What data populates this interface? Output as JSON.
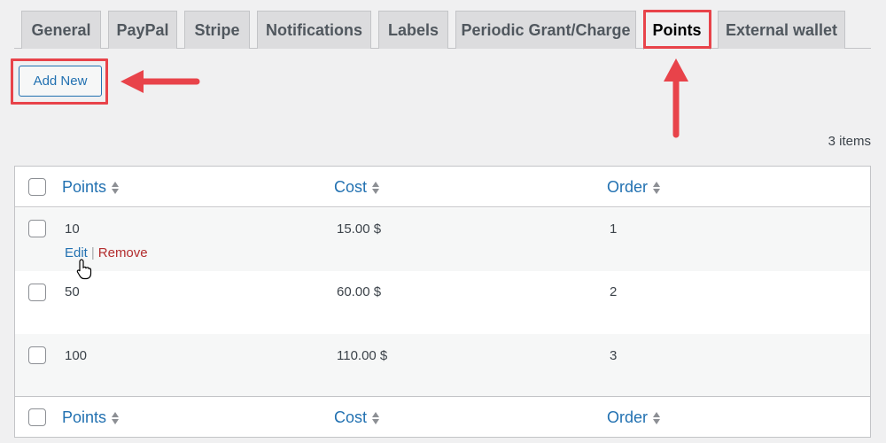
{
  "tabs": [
    {
      "label": "General"
    },
    {
      "label": "PayPal"
    },
    {
      "label": "Stripe"
    },
    {
      "label": "Notifications"
    },
    {
      "label": "Labels"
    },
    {
      "label": "Periodic Grant/Charge"
    },
    {
      "label": "Points",
      "active": true
    },
    {
      "label": "External wallet"
    }
  ],
  "toolbar": {
    "add_new_label": "Add New"
  },
  "items_count": "3 items",
  "table": {
    "columns": [
      "Points",
      "Cost",
      "Order"
    ],
    "rows": [
      {
        "points": "10",
        "cost": "15.00 $",
        "order": "1"
      },
      {
        "points": "50",
        "cost": "60.00 $",
        "order": "2"
      },
      {
        "points": "100",
        "cost": "110.00 $",
        "order": "3"
      }
    ],
    "row_actions": {
      "edit": "Edit",
      "separator": "|",
      "remove": "Remove"
    }
  },
  "colors": {
    "accent": "#2271b1",
    "annotation": "#e8434a",
    "remove": "#b32d2e"
  },
  "icons": [
    "sort-icon",
    "hand-pointer-icon",
    "arrow-left-icon",
    "arrow-up-icon"
  ]
}
